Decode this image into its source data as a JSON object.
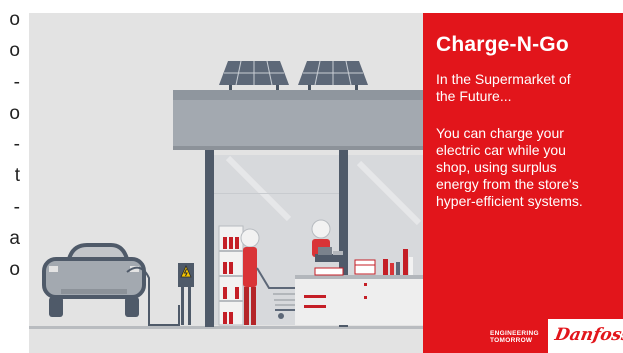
{
  "left_fragment": [
    "o",
    "o",
    "-",
    "o",
    "-",
    "t",
    "-",
    "a",
    "o"
  ],
  "panel": {
    "title": "Charge-N-Go",
    "subtitle": [
      "In the Supermarket of",
      "the Future..."
    ],
    "body": [
      "You can charge your",
      "electric car while you",
      "shop, using surplus",
      "energy from the store's",
      "hyper-efficient systems."
    ],
    "tagline": [
      "ENGINEERING",
      "TOMORROW"
    ],
    "logo": "Danfoss"
  },
  "colors": {
    "brand_red": "#e2151b",
    "scene_bg": "#e3e3e3",
    "roof_dark": "#4a5563"
  },
  "icons": [
    "solar-panel-icon",
    "electric-car-icon",
    "charging-station-icon",
    "high-voltage-warning-icon",
    "shopping-cart-icon",
    "shopper-figure-icon",
    "cashier-figure-icon"
  ]
}
